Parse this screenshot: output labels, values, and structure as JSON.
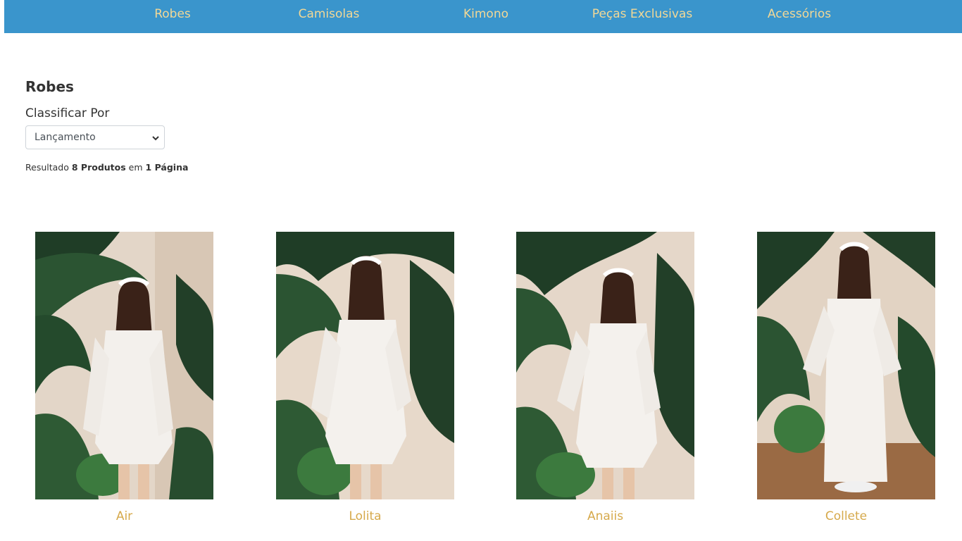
{
  "nav": {
    "items": [
      {
        "label": "Robes"
      },
      {
        "label": "Camisolas"
      },
      {
        "label": "Kimono"
      },
      {
        "label": "Peças Exclusivas"
      },
      {
        "label": "Acessórios"
      }
    ]
  },
  "page": {
    "title": "Robes",
    "sort_label": "Classificar Por",
    "sort_selected": "Lançamento",
    "results_prefix": "Resultado",
    "results_count": "8 Produtos",
    "results_mid": "em",
    "results_pages": "1 Página"
  },
  "products": [
    {
      "name": "Air"
    },
    {
      "name": "Lolita"
    },
    {
      "name": "Anaiis"
    },
    {
      "name": "Collete"
    }
  ],
  "colors": {
    "nav_bg": "#3a95cc",
    "nav_text": "#f2d896",
    "product_name": "#d6a94b"
  }
}
